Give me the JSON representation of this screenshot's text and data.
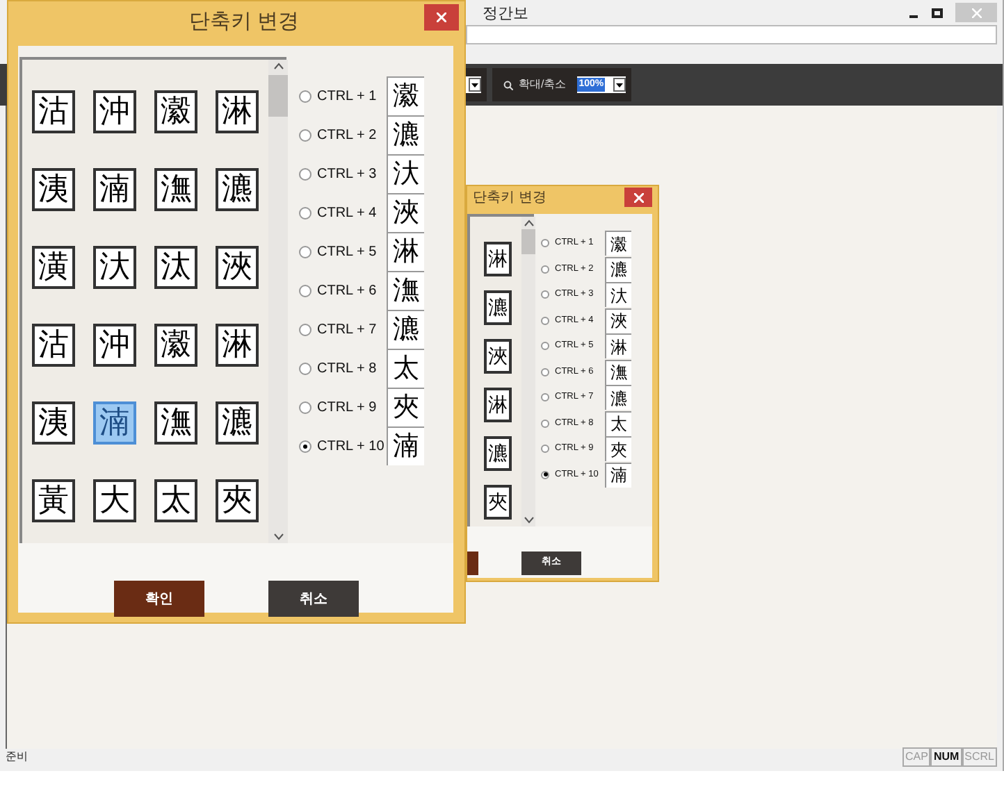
{
  "app_window": {
    "title": "정간보",
    "toolbar": {
      "zoom_label": "확대/축소",
      "zoom_value": "100%"
    }
  },
  "dialogs": [
    {
      "title": "단축키 변경",
      "grid": [
        [
          {
            "char": "沽",
            "selected": false
          },
          {
            "char": "沖",
            "selected": false
          },
          {
            "char": "瀫",
            "selected": false
          },
          {
            "char": "淋",
            "selected": false
          }
        ],
        [
          {
            "char": "洟",
            "selected": false
          },
          {
            "char": "湳",
            "selected": false
          },
          {
            "char": "潕",
            "selected": false
          },
          {
            "char": "瀌",
            "selected": false
          }
        ],
        [
          {
            "char": "潢",
            "selected": false
          },
          {
            "char": "汏",
            "selected": false
          },
          {
            "char": "汰",
            "selected": false
          },
          {
            "char": "浹",
            "selected": false
          }
        ],
        [
          {
            "char": "沽",
            "selected": false
          },
          {
            "char": "沖",
            "selected": false
          },
          {
            "char": "瀫",
            "selected": false
          },
          {
            "char": "淋",
            "selected": false
          }
        ],
        [
          {
            "char": "洟",
            "selected": false
          },
          {
            "char": "湳",
            "selected": true
          },
          {
            "char": "潕",
            "selected": false
          },
          {
            "char": "瀌",
            "selected": false
          }
        ],
        [
          {
            "char": "黃",
            "selected": false
          },
          {
            "char": "大",
            "selected": false
          },
          {
            "char": "太",
            "selected": false
          },
          {
            "char": "夾",
            "selected": false
          }
        ]
      ],
      "shortcuts": [
        {
          "label": "CTRL + 1",
          "char": "瀫",
          "selected": false
        },
        {
          "label": "CTRL + 2",
          "char": "瀌",
          "selected": false
        },
        {
          "label": "CTRL + 3",
          "char": "汏",
          "selected": false
        },
        {
          "label": "CTRL + 4",
          "char": "浹",
          "selected": false
        },
        {
          "label": "CTRL + 5",
          "char": "淋",
          "selected": false
        },
        {
          "label": "CTRL + 6",
          "char": "潕",
          "selected": false
        },
        {
          "label": "CTRL + 7",
          "char": "瀌",
          "selected": false
        },
        {
          "label": "CTRL + 8",
          "char": "太",
          "selected": false
        },
        {
          "label": "CTRL + 9",
          "char": "夾",
          "selected": false
        },
        {
          "label": "CTRL + 10",
          "char": "湳",
          "selected": true
        }
      ],
      "buttons": [
        {
          "kind": "confirm",
          "label": "확인"
        },
        {
          "kind": "cancel",
          "label": "취소"
        }
      ]
    },
    {
      "title": "단축키 변경",
      "grid": [
        [
          {
            "char": "淋",
            "selected": false
          }
        ],
        [
          {
            "char": "瀌",
            "selected": false
          }
        ],
        [
          {
            "char": "浹",
            "selected": false
          }
        ],
        [
          {
            "char": "淋",
            "selected": false
          }
        ],
        [
          {
            "char": "瀌",
            "selected": false
          }
        ],
        [
          {
            "char": "夾",
            "selected": false
          }
        ]
      ],
      "shortcuts": [
        {
          "label": "CTRL + 1",
          "char": "瀫",
          "selected": false
        },
        {
          "label": "CTRL + 2",
          "char": "瀌",
          "selected": false
        },
        {
          "label": "CTRL + 3",
          "char": "汏",
          "selected": false
        },
        {
          "label": "CTRL + 4",
          "char": "浹",
          "selected": false
        },
        {
          "label": "CTRL + 5",
          "char": "淋",
          "selected": false
        },
        {
          "label": "CTRL + 6",
          "char": "潕",
          "selected": false
        },
        {
          "label": "CTRL + 7",
          "char": "瀌",
          "selected": false
        },
        {
          "label": "CTRL + 8",
          "char": "太",
          "selected": false
        },
        {
          "label": "CTRL + 9",
          "char": "夾",
          "selected": false
        },
        {
          "label": "CTRL + 10",
          "char": "湳",
          "selected": true
        }
      ],
      "buttons": [
        {
          "kind": "confirm"
        },
        {
          "kind": "cancel",
          "label": "취소"
        }
      ]
    }
  ],
  "status_bar": {
    "text": "준비",
    "indicators": [
      {
        "label": "CAP",
        "on": false
      },
      {
        "label": "NUM",
        "on": true
      },
      {
        "label": "SCRL",
        "on": false
      }
    ]
  }
}
